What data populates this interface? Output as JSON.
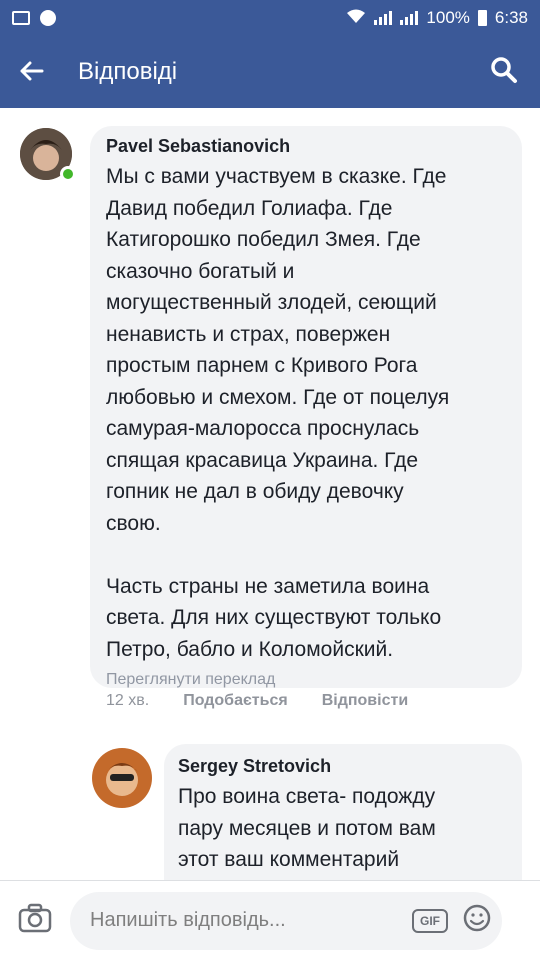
{
  "status_bar": {
    "battery": "100%",
    "time": "6:38"
  },
  "header": {
    "title": "Відповіді",
    "back_icon": "arrow-left-icon",
    "search_icon": "search-icon"
  },
  "comments": [
    {
      "author": "Pavel Sebastianovich",
      "text": "Мы с вами участвуем в сказке. Где\nДавид победил Голиафа. Где\nКатигорошко победил Змея. Где\nсказочно богатый и\nмогущественный злодей, сеющий\nненависть и страх, повержен\nпростым парнем с Кривого Рога\nлюбовью и смехом. Где от поцелуя\nсамурая-малоросса проснулась\nспящая красавица Украина. Где\nгопник не дал в обиду девочку\nсвою.\n\nЧасть страны не заметила воина\nсвета. Для них существуют только\nПетро, бабло и Коломойский.",
      "translate_link": "Переглянути переклад",
      "time": "12 хв.",
      "like_label": "Подобається",
      "reply_label": "Відповісти",
      "online": true
    },
    {
      "author": "Sergey Stretovich",
      "text": "Про воина света- подожду\nпару месяцев и потом вам\nэтот ваш комментарий"
    }
  ],
  "composer": {
    "placeholder": "Напишіть відповідь...",
    "gif_label": "GIF",
    "camera_icon": "camera-icon",
    "emoji_icon": "smiley-icon"
  },
  "colors": {
    "brand": "#3b5998",
    "bubble": "#f2f3f5",
    "online": "#42b72a",
    "meta_text": "#90949c"
  }
}
